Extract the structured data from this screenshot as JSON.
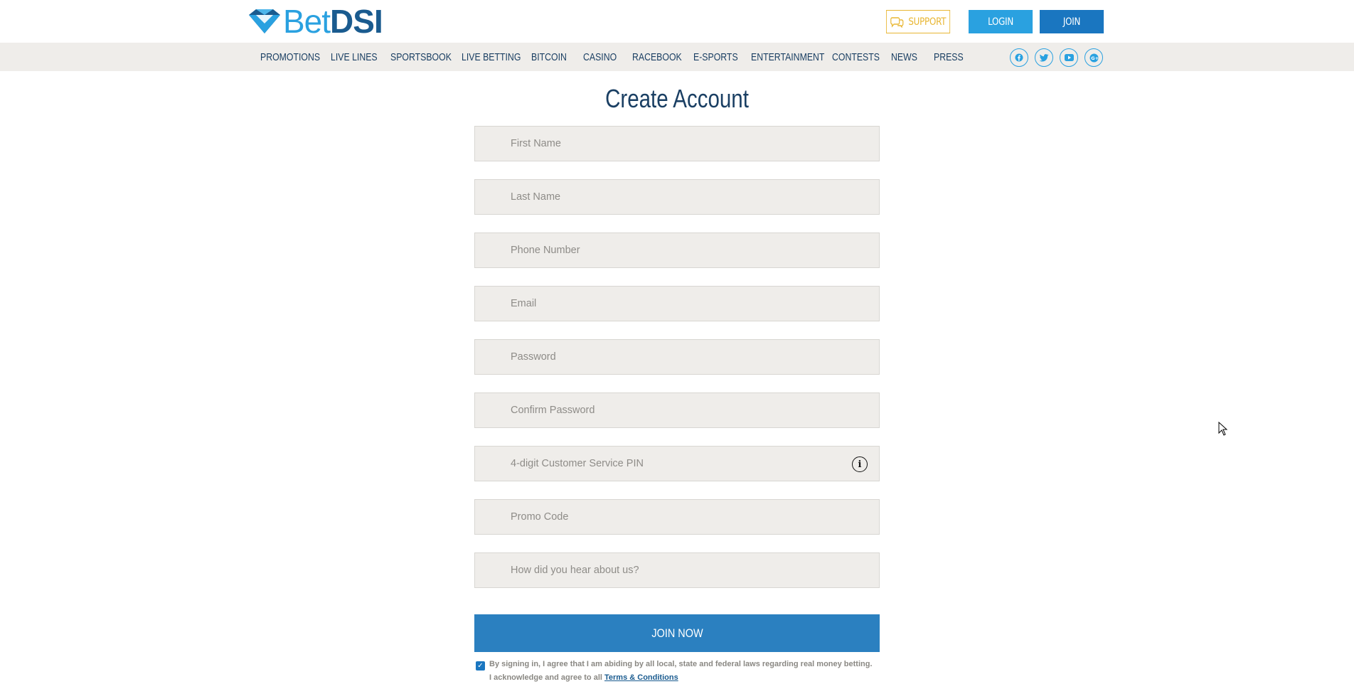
{
  "header": {
    "logo": {
      "part1": "Bet",
      "part2": "DSI"
    },
    "support_label": "SUPPORT",
    "login_label": "LOGIN",
    "join_label": "JOIN"
  },
  "nav": {
    "items": [
      "PROMOTIONS",
      "LIVE LINES",
      "SPORTSBOOK",
      "LIVE BETTING",
      "BITCOIN",
      "CASINO",
      "RACEBOOK",
      "E-SPORTS",
      "ENTERTAINMENT",
      "CONTESTS",
      "NEWS",
      "PRESS"
    ],
    "social": [
      "facebook",
      "twitter",
      "youtube",
      "google-plus"
    ]
  },
  "form": {
    "title": "Create Account",
    "fields": {
      "first_name": "First Name",
      "last_name": "Last Name",
      "phone": "Phone Number",
      "email": "Email",
      "password": "Password",
      "confirm_password": "Confirm Password",
      "pin": "4-digit Customer Service PIN",
      "promo": "Promo Code",
      "referral": "How did you hear about us?"
    },
    "submit_label": "JOIN NOW",
    "agreement_text": "By signing in, I agree that I am abiding by all local, state and federal laws regarding real money betting. I acknowledge and agree to all",
    "terms_link": "Terms & Conditions",
    "agreement_checked": true
  },
  "colors": {
    "brand_dark": "#1a3f63",
    "brand_light": "#2aa1e0",
    "join_blue": "#1a76c0",
    "support_gold": "#e8b632"
  }
}
